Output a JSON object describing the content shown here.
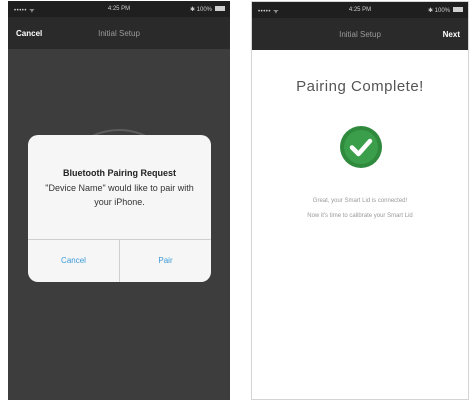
{
  "left_screen": {
    "status_bar": {
      "carrier": "••••• ᯤ",
      "time": "4:25 PM",
      "battery": "✱ 100%"
    },
    "nav": {
      "title": "Initial Setup",
      "left_button": "Cancel"
    },
    "alert": {
      "title": "Bluetooth Pairing Request",
      "message": "\"Device Name\" would like to pair with your iPhone.",
      "cancel_label": "Cancel",
      "pair_label": "Pair"
    }
  },
  "right_screen": {
    "status_bar": {
      "carrier": "••••• ᯤ",
      "time": "4:25 PM",
      "battery": "✱ 100%"
    },
    "nav": {
      "title": "Initial Setup",
      "right_button": "Next"
    },
    "heading": "Pairing Complete!",
    "icon": "check-circle-icon",
    "message_line1": "Great, your Smart Lid is connected!",
    "message_line2": "Now it's time to calibrate your Smart Lid"
  },
  "colors": {
    "accent_green": "#3a9e4a",
    "link_blue": "#3a9ad9",
    "dark_bar": "#2a2a2a"
  }
}
